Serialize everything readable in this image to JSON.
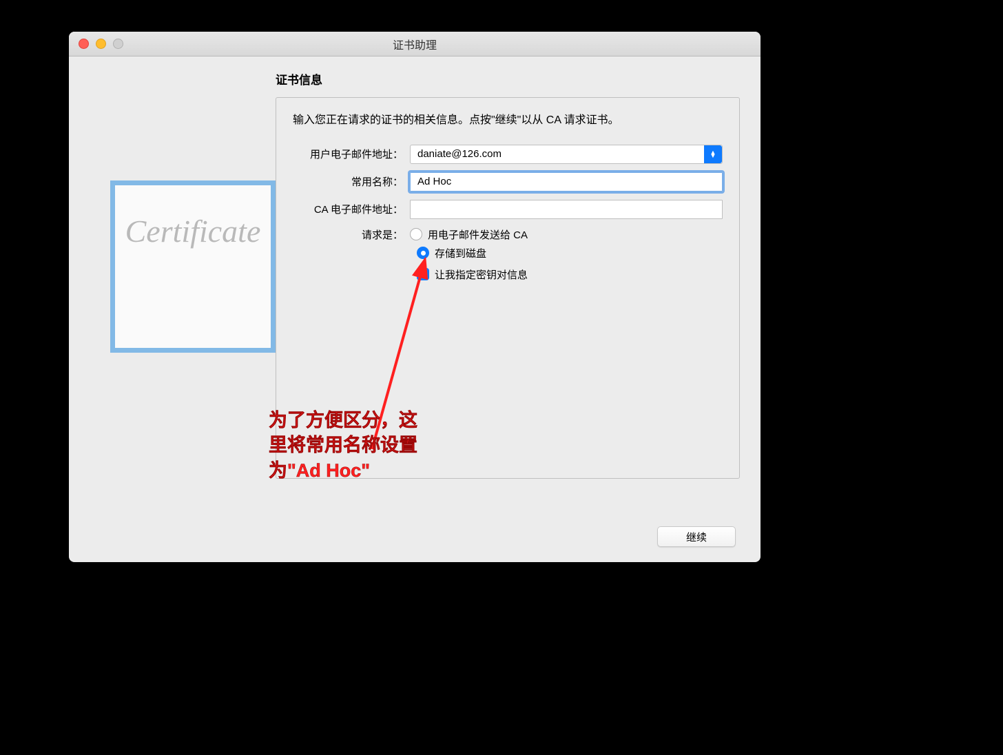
{
  "window": {
    "title": "证书助理"
  },
  "section": {
    "heading": "证书信息",
    "instruction": "输入您正在请求的证书的相关信息。点按\"继续\"以从 CA 请求证书。"
  },
  "certificate_image_text": "Certificate",
  "form": {
    "email_label": "用户电子邮件地址：",
    "email_value": "daniate@126.com",
    "common_name_label": "常用名称：",
    "common_name_value": "Ad Hoc",
    "ca_email_label": "CA 电子邮件地址：",
    "ca_email_value": "",
    "request_label": "请求是：",
    "option_email_to_ca": "用电子邮件发送给 CA",
    "option_save_to_disk": "存储到磁盘",
    "option_specify_keypair": "让我指定密钥对信息"
  },
  "annotation": {
    "line1": "为了方便区分，这",
    "line2": "里将常用名称设置",
    "line3": "为\"Ad Hoc\""
  },
  "buttons": {
    "continue": "继续"
  }
}
